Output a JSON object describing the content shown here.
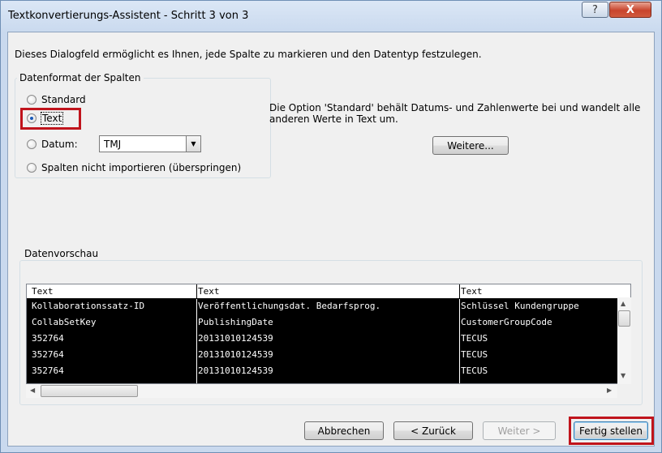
{
  "window": {
    "title": "Textkonvertierungs-Assistent - Schritt 3 von 3",
    "help_label": "?",
    "close_label": "X"
  },
  "description": "Dieses Dialogfeld ermöglicht es Ihnen, jede Spalte zu markieren und den Datentyp festzulegen.",
  "format_group": {
    "label": "Datenformat der Spalten",
    "options": [
      {
        "label": "Standard",
        "checked": false
      },
      {
        "label": "Text",
        "checked": true
      },
      {
        "label": "Datum:",
        "checked": false
      },
      {
        "label": "Spalten nicht importieren (überspringen)",
        "checked": false
      }
    ],
    "date_format": "TMJ"
  },
  "info_text": "Die Option 'Standard' behält Datums- und Zahlenwerte bei und wandelt alle anderen Werte in Text um.",
  "more_button": "Weitere...",
  "preview": {
    "label": "Datenvorschau",
    "headers": [
      "Text",
      "Text",
      "Text"
    ],
    "rows": [
      [
        "Kollaborationssatz-ID",
        "Veröffentlichungsdat. Bedarfsprog.",
        "Schlüssel Kundengruppe"
      ],
      [
        "CollabSetKey",
        "PublishingDate",
        "CustomerGroupCode"
      ],
      [
        "352764",
        "20131010124539",
        "TECUS"
      ],
      [
        "352764",
        "20131010124539",
        "TECUS"
      ],
      [
        "352764",
        "20131010124539",
        "TECUS"
      ]
    ]
  },
  "buttons": {
    "cancel": "Abbrechen",
    "back": "< Zurück",
    "next": "Weiter >",
    "finish": "Fertig stellen"
  },
  "colors": {
    "highlight": "#c0141c",
    "selection_bg": "#000000",
    "close_button": "#c8442c"
  }
}
